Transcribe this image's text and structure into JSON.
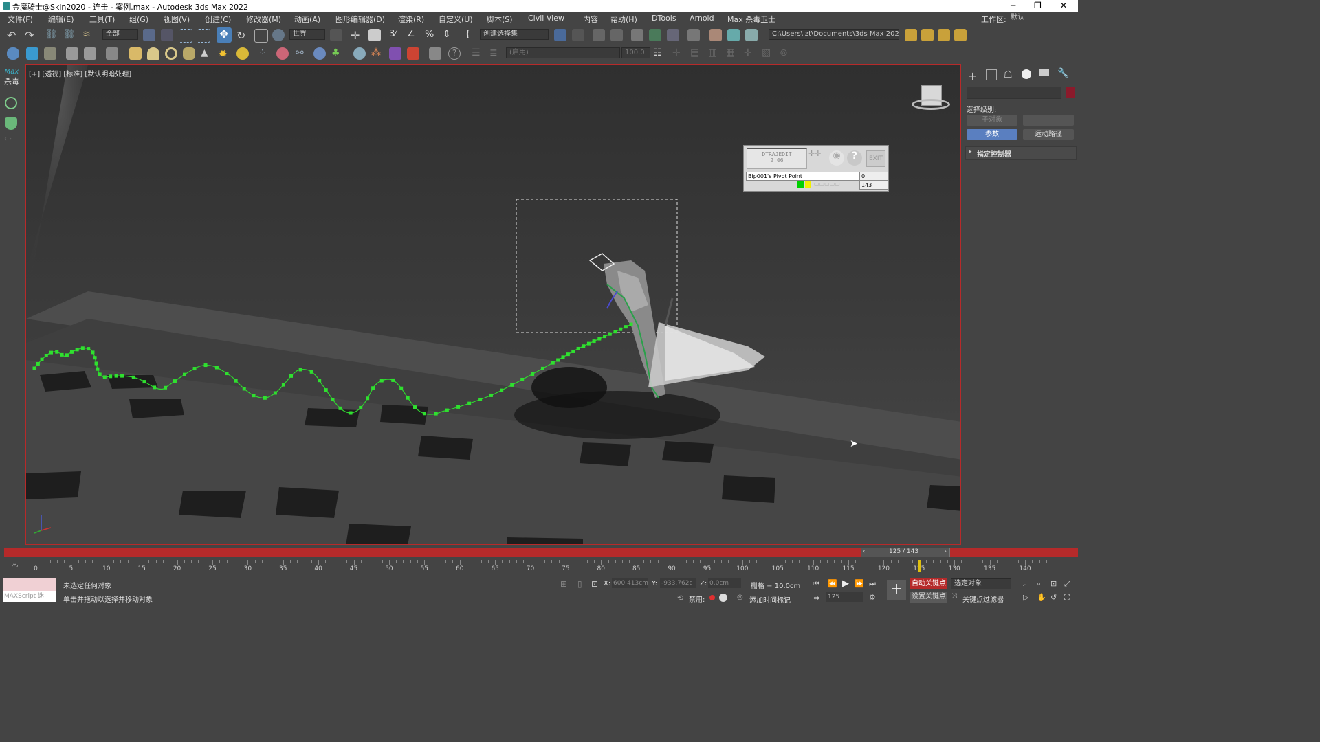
{
  "window": {
    "title": "金魔骑士@Skin2020 - 连击 - 案例.max - Autodesk 3ds Max 2022",
    "controls": [
      "─",
      "❐",
      "✕"
    ]
  },
  "menu": {
    "items": [
      "文件(F)",
      "编辑(E)",
      "工具(T)",
      "组(G)",
      "视图(V)",
      "创建(C)",
      "修改器(M)",
      "动画(A)",
      "图形编辑器(D)",
      "渲染(R)",
      "自定义(U)",
      "脚本(S)",
      "Civil View",
      "内容",
      "帮助(H)",
      "DTools",
      "Arnold",
      "Max 杀毒卫士"
    ],
    "workspace_label": "工作区:",
    "workspace_value": "默认"
  },
  "toolbar1": {
    "filter_value": "全部",
    "coord_system": "世界",
    "selection_set": "创建选择集",
    "project_path": "C:\\Users\\lzt\\Documents\\3ds Max 2022"
  },
  "toolbar2": {
    "layer_placeholder": "(启用)",
    "value_field": "100.0"
  },
  "leftbar": {
    "max_label": "Max",
    "antivirus_label": "杀毒"
  },
  "viewport": {
    "label": "[+] [透视] [标准] [默认明暗处理]",
    "dtraj": {
      "title": "DTRAJEDIT",
      "version": "2.06",
      "exit_label": "EXIT",
      "object_name": "Bip001's Pivot Point",
      "frame_start": "0",
      "frame_end": "143"
    }
  },
  "rightpanel": {
    "selection_level_label": "选择级别:",
    "subobject_button": "子对象",
    "params_tab": "参数",
    "motion_path_tab": "运动路径",
    "assign_controller": "指定控制器",
    "accent_color": "#8b1a2b"
  },
  "timeline": {
    "frame_display": "125 / 143",
    "current_frame": 125,
    "max_frame": 143,
    "ticks": [
      "0",
      "5",
      "10",
      "15",
      "20",
      "25",
      "30",
      "35",
      "40",
      "45",
      "50",
      "55",
      "60",
      "65",
      "70",
      "75",
      "80",
      "85",
      "90",
      "95",
      "100",
      "105",
      "110",
      "115",
      "120",
      "125",
      "130",
      "135",
      "140"
    ]
  },
  "status": {
    "maxscript_label": "MAXScript 迷",
    "status_line1": "未选定任何对象",
    "status_line2": "单击并拖动以选择并移动对象",
    "x_label": "X:",
    "x_value": "600.413cm",
    "y_label": "Y:",
    "y_value": "-933.762c",
    "z_label": "Z:",
    "z_value": "0.0cm",
    "grid_label": "栅格 = 10.0cm",
    "disable_label": "禁用:",
    "add_time_tag": "添加时间标记",
    "auto_key": "自动关键点",
    "set_key": "设置关键点",
    "selected_object": "选定对象",
    "key_filters": "关键点过滤器",
    "frame_field": "125",
    "auto_key_color": "#b52a2a"
  }
}
